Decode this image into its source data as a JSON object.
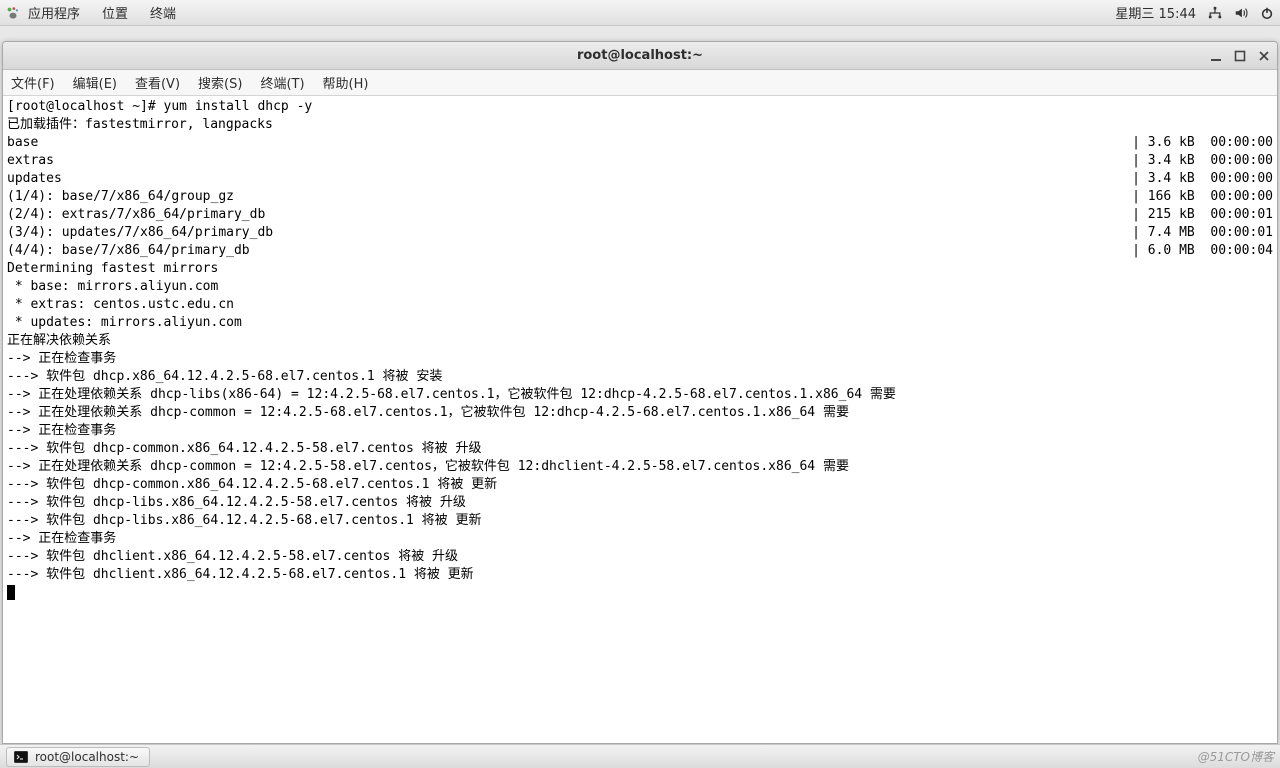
{
  "panel": {
    "apps": "应用程序",
    "places": "位置",
    "terminal": "终端",
    "datetime": "星期三 15:44"
  },
  "window": {
    "title": "root@localhost:~"
  },
  "menubar": {
    "file": "文件(F)",
    "edit": "编辑(E)",
    "view": "查看(V)",
    "search": "搜索(S)",
    "terminal": "终端(T)",
    "help": "帮助(H)"
  },
  "terminal": {
    "prompt": "[root@localhost ~]# yum install dhcp -y",
    "plugins": "已加载插件：fastestmirror, langpacks",
    "repos": [
      {
        "name": "base",
        "size": "3.6 kB",
        "time": "00:00:00"
      },
      {
        "name": "extras",
        "size": "3.4 kB",
        "time": "00:00:00"
      },
      {
        "name": "updates",
        "size": "3.4 kB",
        "time": "00:00:00"
      },
      {
        "name": "(1/4): base/7/x86_64/group_gz",
        "size": "166 kB",
        "time": "00:00:00"
      },
      {
        "name": "(2/4): extras/7/x86_64/primary_db",
        "size": "215 kB",
        "time": "00:00:01"
      },
      {
        "name": "(3/4): updates/7/x86_64/primary_db",
        "size": "7.4 MB",
        "time": "00:00:01"
      },
      {
        "name": "(4/4): base/7/x86_64/primary_db",
        "size": "6.0 MB",
        "time": "00:00:04"
      }
    ],
    "determining": "Determining fastest mirrors",
    "mirrors": [
      " * base: mirrors.aliyun.com",
      " * extras: centos.ustc.edu.cn",
      " * updates: mirrors.aliyun.com"
    ],
    "resolve": [
      "正在解决依赖关系",
      "--> 正在检查事务",
      "---> 软件包 dhcp.x86_64.12.4.2.5-68.el7.centos.1 将被 安装",
      "--> 正在处理依赖关系 dhcp-libs(x86-64) = 12:4.2.5-68.el7.centos.1，它被软件包 12:dhcp-4.2.5-68.el7.centos.1.x86_64 需要",
      "--> 正在处理依赖关系 dhcp-common = 12:4.2.5-68.el7.centos.1，它被软件包 12:dhcp-4.2.5-68.el7.centos.1.x86_64 需要",
      "--> 正在检查事务",
      "---> 软件包 dhcp-common.x86_64.12.4.2.5-58.el7.centos 将被 升级",
      "--> 正在处理依赖关系 dhcp-common = 12:4.2.5-58.el7.centos，它被软件包 12:dhclient-4.2.5-58.el7.centos.x86_64 需要",
      "---> 软件包 dhcp-common.x86_64.12.4.2.5-68.el7.centos.1 将被 更新",
      "---> 软件包 dhcp-libs.x86_64.12.4.2.5-58.el7.centos 将被 升级",
      "---> 软件包 dhcp-libs.x86_64.12.4.2.5-68.el7.centos.1 将被 更新",
      "--> 正在检查事务",
      "---> 软件包 dhclient.x86_64.12.4.2.5-58.el7.centos 将被 升级",
      "---> 软件包 dhclient.x86_64.12.4.2.5-68.el7.centos.1 将被 更新"
    ]
  },
  "taskbar": {
    "item": "root@localhost:~"
  },
  "watermark": "@51CTO博客"
}
